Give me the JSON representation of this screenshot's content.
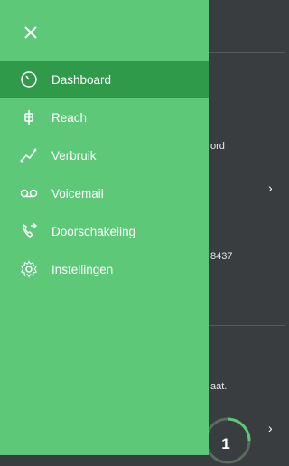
{
  "drawer": {
    "items": [
      {
        "label": "Dashboard",
        "icon": "dashboard-icon",
        "active": true
      },
      {
        "label": "Reach",
        "icon": "reach-icon",
        "active": false
      },
      {
        "label": "Verbruik",
        "icon": "usage-icon",
        "active": false
      },
      {
        "label": "Voicemail",
        "icon": "voicemail-icon",
        "active": false
      },
      {
        "label": "Doorschakeling",
        "icon": "call-forward-icon",
        "active": false
      },
      {
        "label": "Instellingen",
        "icon": "settings-icon",
        "active": false
      }
    ]
  },
  "background": {
    "text1": "ord",
    "text2": "8437",
    "text3": "aat.",
    "badge_count": "1"
  },
  "colors": {
    "drawer": "#5dc878",
    "active_item": "#2f9b4a",
    "background": "#3a3d40"
  }
}
